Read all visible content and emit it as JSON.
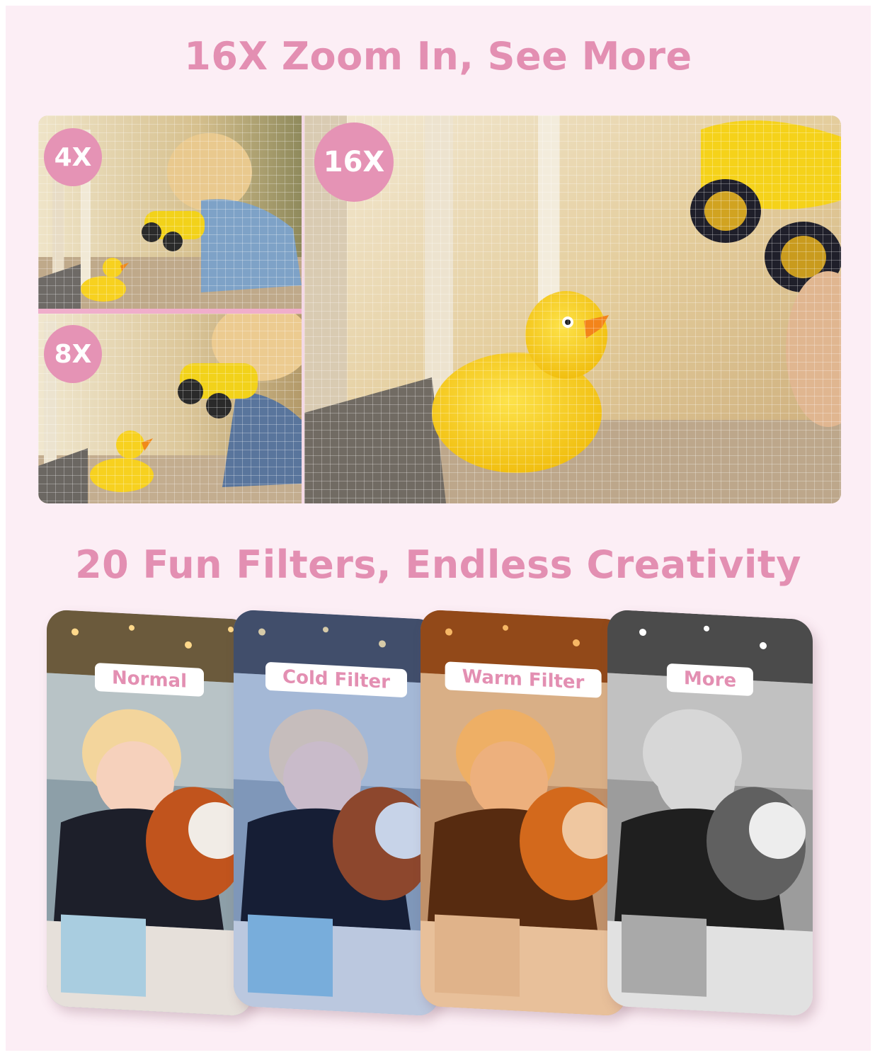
{
  "sections": {
    "zoom": {
      "title": "16X Zoom In, See More",
      "badges": [
        "4X",
        "8X",
        "16X"
      ]
    },
    "filters": {
      "title": "20 Fun Filters, Endless Creativity",
      "labels": [
        "Normal",
        "Cold Filter",
        "Warm Filter",
        "More"
      ]
    }
  },
  "colors": {
    "accent": "#e38fb2",
    "background": "#fceef5",
    "badge": "#e593b5"
  }
}
